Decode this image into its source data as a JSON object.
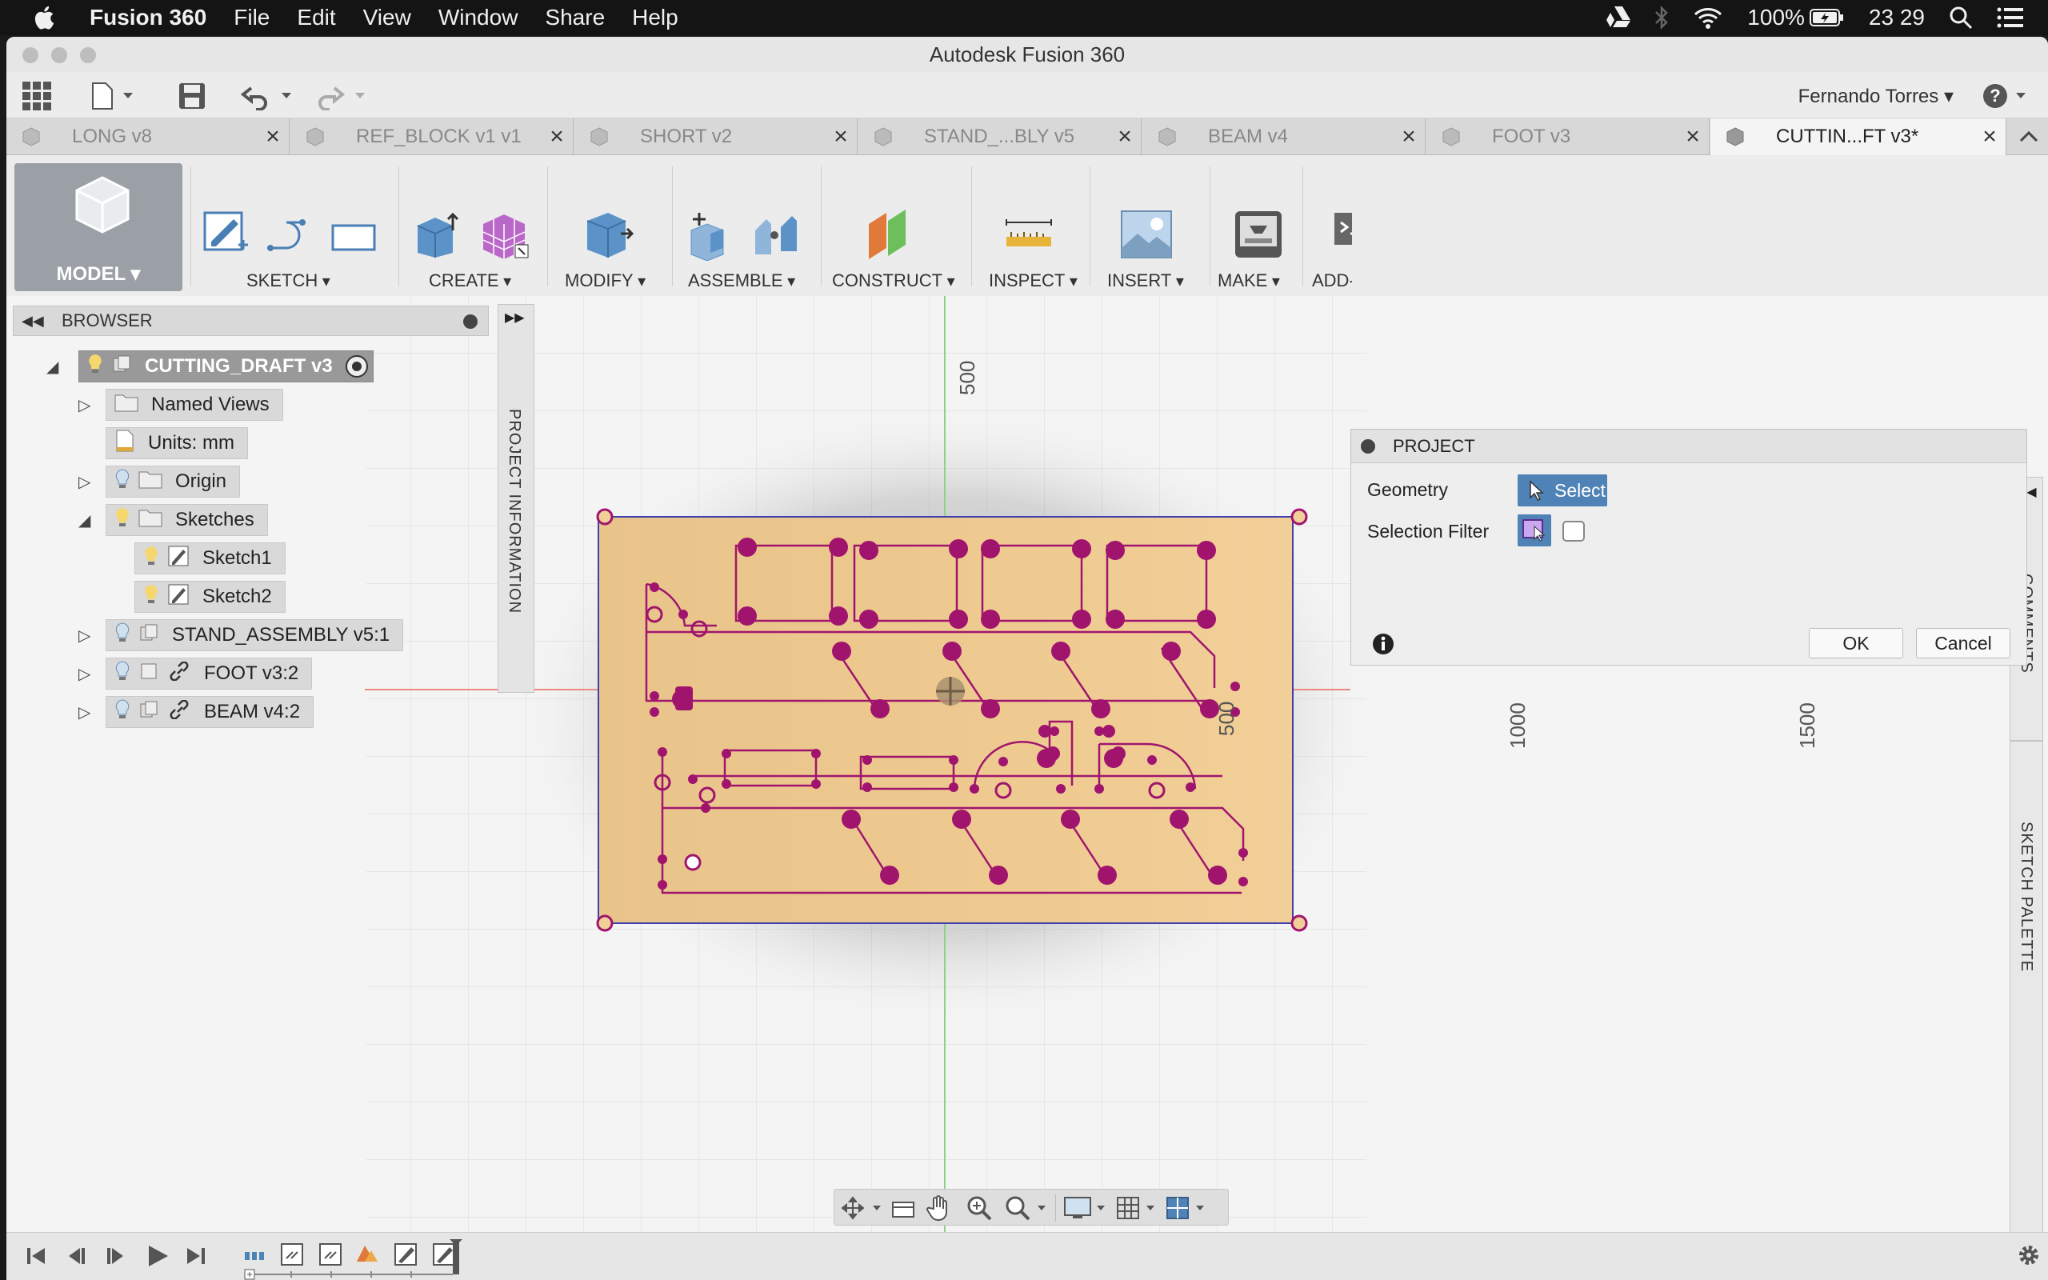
{
  "menubar": {
    "app_name": "Fusion 360",
    "menus": [
      "File",
      "Edit",
      "View",
      "Window",
      "Share",
      "Help"
    ],
    "battery": "100%",
    "clock": "23 29"
  },
  "window": {
    "title": "Autodesk Fusion 360",
    "user": "Fernando Torres"
  },
  "tabs": [
    {
      "label": "LONG v8"
    },
    {
      "label": "REF_BLOCK v1 v1"
    },
    {
      "label": "SHORT v2"
    },
    {
      "label": "STAND_...BLY v5"
    },
    {
      "label": "BEAM v4"
    },
    {
      "label": "FOOT v3"
    },
    {
      "label": "CUTTIN...FT v3*"
    }
  ],
  "ribbon": {
    "workspace": "MODEL",
    "groups": [
      "SKETCH",
      "CREATE",
      "MODIFY",
      "ASSEMBLE",
      "CONSTRUCT",
      "INSPECT",
      "INSERT",
      "MAKE",
      "ADD-"
    ]
  },
  "browser": {
    "title": "BROWSER",
    "root": "CUTTING_DRAFT v3",
    "nodes": {
      "named_views": "Named Views",
      "units": "Units: mm",
      "origin": "Origin",
      "sketches": "Sketches",
      "sketch1": "Sketch1",
      "sketch2": "Sketch2",
      "stand_assembly": "STAND_ASSEMBLY v5:1",
      "foot": "FOOT v3:2",
      "beam": "BEAM v4:2"
    }
  },
  "project_info_label": "PROJECT INFORMATION",
  "dialog": {
    "title": "PROJECT",
    "geometry_label": "Geometry",
    "select_label": "Select",
    "filter_label": "Selection Filter",
    "ok_label": "OK",
    "cancel_label": "Cancel"
  },
  "side_panels": {
    "comments": "COMMENTS",
    "palette": "SKETCH PALETTE"
  },
  "viewport": {
    "axis_labels": [
      "500",
      "1000",
      "1500",
      "500"
    ],
    "sheet_color": "#edc98f",
    "sketch_color": "#a0146e"
  },
  "colors": {
    "accent": "#4f83b8",
    "axis_red": "#e88a7e",
    "axis_green": "#8fd08a"
  }
}
